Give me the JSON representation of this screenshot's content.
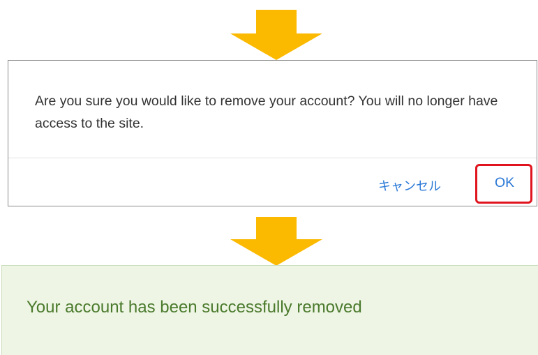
{
  "dialog": {
    "message": "Are you sure  you would like to remove your account? You will no longer have access to the site.",
    "cancel_label": "キャンセル",
    "ok_label": "OK"
  },
  "success": {
    "message": "Your account has been successfully removed"
  },
  "colors": {
    "arrow": "#fbb900",
    "link_blue": "#2a78d6",
    "highlight_red": "#e0141e",
    "success_bg": "#eef5e4",
    "success_text": "#4a7a2c"
  },
  "icons": {
    "flow_arrow": "arrow-down-icon"
  }
}
